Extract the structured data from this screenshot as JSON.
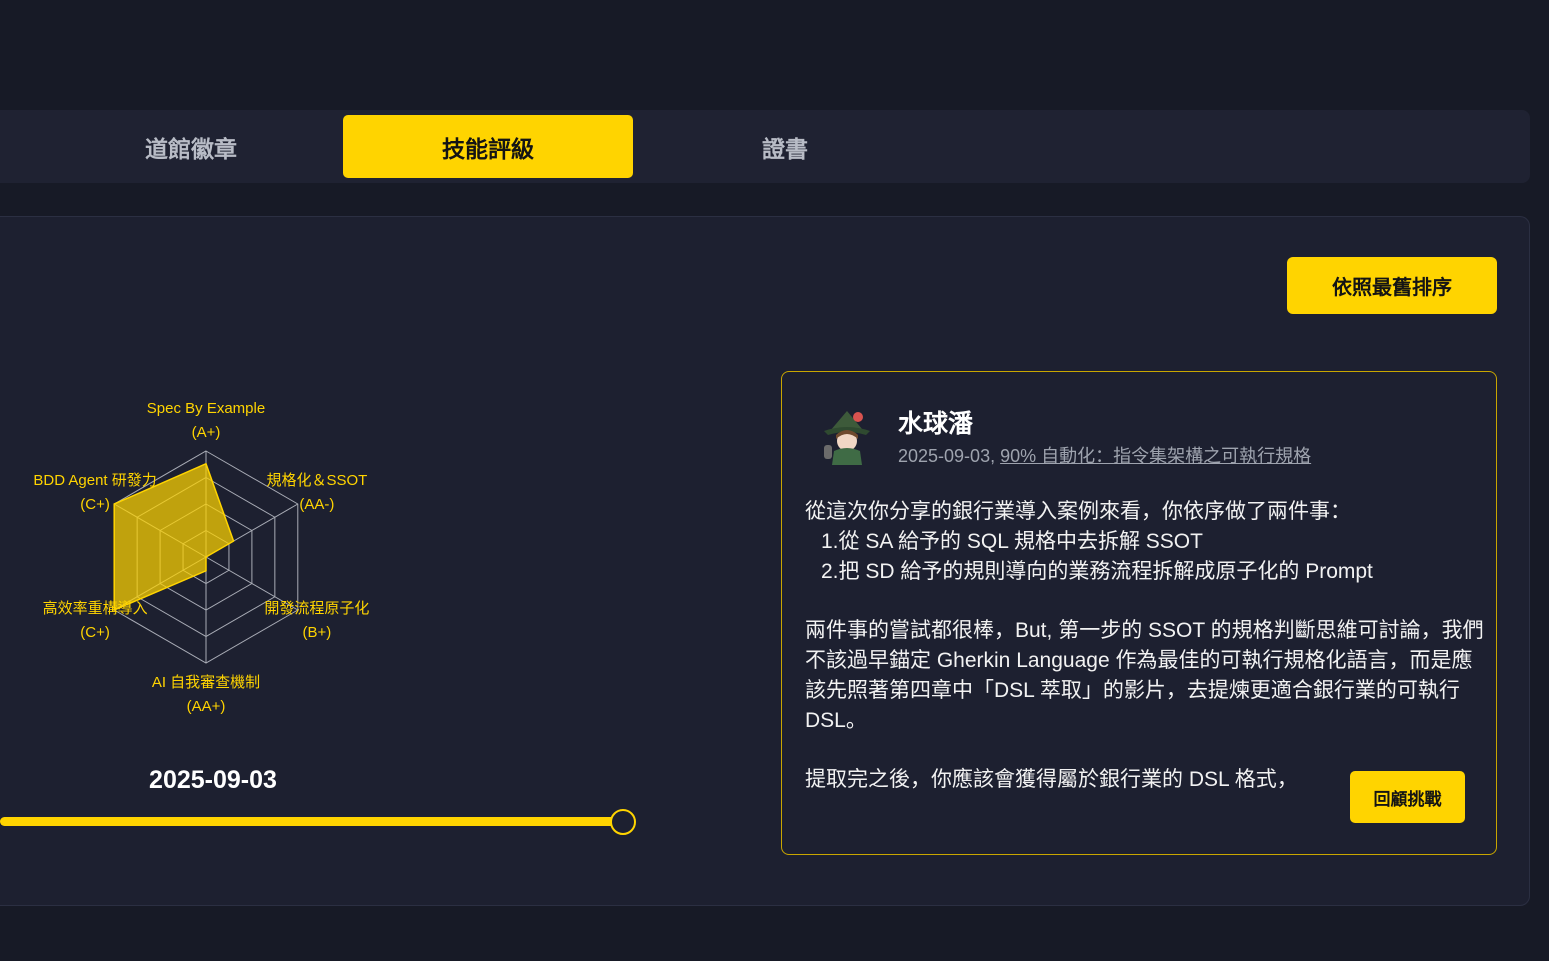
{
  "tabs": [
    {
      "label": "道館徽章",
      "active": false
    },
    {
      "label": "技能評級",
      "active": true
    },
    {
      "label": "證書",
      "active": false
    }
  ],
  "sort_button": {
    "label": "依照最舊排序"
  },
  "radar": {
    "axes": [
      {
        "name": "Spec By Example",
        "grade": "(A+)"
      },
      {
        "name": "規格化＆SSOT",
        "grade": "(AA-)"
      },
      {
        "name": "開發流程原子化",
        "grade": "(B+)"
      },
      {
        "name": "AI 自我審查機制",
        "grade": "(AA+)"
      },
      {
        "name": "高效率重構導入",
        "grade": "(C+)"
      },
      {
        "name": "BDD Agent 研發力",
        "grade": "(C+)"
      }
    ],
    "values": [
      0.88,
      0.3,
      0.0,
      0.13,
      1.0,
      1.0
    ],
    "rings": 4,
    "color": "#ffd400"
  },
  "timeline": {
    "date": "2025-09-03",
    "position": 1.0
  },
  "card": {
    "author": "水球潘",
    "date": "2025-09-03,",
    "link": "90% 自動化：指令集架構之可執行規格",
    "para1": "從這次你分享的銀行業導入案例來看，你依序做了兩件事：",
    "item1": "1.從 SA  給予的 SQL 規格中去拆解 SSOT",
    "item2": "2.把 SD 給予的規則導向的業務流程拆解成原子化的 Prompt",
    "para2": "兩件事的嘗試都很棒，But, 第一步的 SSOT 的規格判斷思維可討論，我們不該過早錨定 Gherkin Language 作為最佳的可執行規格化語言，而是應該先照著第四章中「DSL 萃取」的影片，去提煉更適合銀行業的可執行 DSL。",
    "para3": "提取完之後，你應該會獲得屬於銀行業的 DSL 格式，",
    "review_button": "回顧挑戰"
  }
}
